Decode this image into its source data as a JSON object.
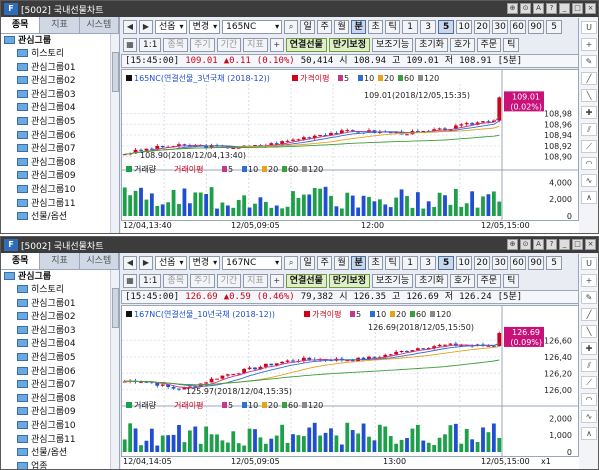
{
  "windows": [
    {
      "title": "[5002] 국내선물차트",
      "left_tabs": [
        "종목",
        "지표",
        "시스템"
      ],
      "tree_root": "관심그룹",
      "tree_items": [
        "히스토리",
        "관심그룹01",
        "관심그룹02",
        "관심그룹03",
        "관심그룹04",
        "관심그룹05",
        "관심그룹06",
        "관심그룹07",
        "관심그룹08",
        "관심그룹09",
        "관심그룹10",
        "관심그룹11",
        "선물/옵션"
      ],
      "code_label": "선옵",
      "change_label": "변경",
      "symbol": "165NC",
      "periods": [
        "일",
        "주",
        "월",
        "분",
        "초",
        "틱"
      ],
      "period_selected": "분",
      "intervals": [
        "1",
        "3",
        "5",
        "10",
        "20",
        "30",
        "60",
        "90",
        "5"
      ],
      "interval_selected": "5",
      "toolbar2": [
        "1:1",
        "종목",
        "주기",
        "기간",
        "지표",
        "연결선물",
        "만기보정",
        "보조기능",
        "초기화",
        "호가",
        "주문",
        "틱"
      ],
      "info": {
        "time": "[15:45:00]",
        "price": "109.01",
        "change": "▲0.11",
        "pct": "(0.10%)",
        "volume": "50,414",
        "open_label": "시",
        "open": "108.94",
        "high_label": "고",
        "high": "109.01",
        "low_label": "저",
        "low": "108.91",
        "period": "[5분]"
      },
      "legend": {
        "name": "165NC(연결선물_3년국채 (2018-12))",
        "ma_label": "가격이평",
        "ma": [
          "5",
          "10",
          "20",
          "60",
          "120"
        ]
      },
      "price_tag": "109.01",
      "pct_tag": "(0.02%)",
      "annot_high": "109.01(2018/12/05,15:35)",
      "annot_low": "108.90(2018/12/04,13:40)",
      "y_ticks": [
        "108,98",
        "108,96",
        "108,94",
        "108,92",
        "108,90"
      ],
      "vol_legend": {
        "vol": "거래량",
        "ma": "거래이평",
        "vals": [
          "5",
          "10",
          "20",
          "60",
          "120"
        ]
      },
      "vol_ticks": [
        "4,000",
        "2,000",
        "0"
      ],
      "x_labels": [
        "12/04,13:40",
        "12/05,09:05",
        "12:00",
        "12/05,15:00"
      ],
      "chart_data": {
        "type": "candlestick",
        "symbol": "165NC",
        "price_range": [
          108.89,
          109.02
        ],
        "volume_range": [
          0,
          5000
        ],
        "price_axis_ticks": [
          108.98,
          108.96,
          108.94,
          108.92,
          108.9
        ],
        "volume_axis_ticks": [
          4000,
          2000,
          0
        ],
        "x_axis_ticks": [
          "12/04,13:40",
          "12/05,09:05",
          "12:00",
          "12/05,15:00"
        ],
        "annotations": [
          {
            "text": "109.01(2018/12/05,15:35)",
            "value": 109.01
          },
          {
            "text": "108.90(2018/12/04,13:40)",
            "value": 108.9
          }
        ],
        "last": 109.01,
        "open": 108.94,
        "high": 109.01,
        "low": 108.91
      }
    },
    {
      "title": "[5002] 국내선물차트",
      "left_tabs": [
        "종목",
        "지표",
        "시스템"
      ],
      "tree_root": "관심그룹",
      "tree_items": [
        "히스토리",
        "관심그룹01",
        "관심그룹02",
        "관심그룹03",
        "관심그룹04",
        "관심그룹05",
        "관심그룹06",
        "관심그룹07",
        "관심그룹08",
        "관심그룹09",
        "관심그룹10",
        "관심그룹11",
        "선물/옵션",
        "업종"
      ],
      "code_label": "선옵",
      "change_label": "변경",
      "symbol": "167NC",
      "periods": [
        "일",
        "주",
        "월",
        "분",
        "초",
        "틱"
      ],
      "period_selected": "분",
      "intervals": [
        "1",
        "3",
        "5",
        "10",
        "20",
        "30",
        "60",
        "90",
        "5"
      ],
      "interval_selected": "5",
      "toolbar2": [
        "1:1",
        "종목",
        "주기",
        "기간",
        "지표",
        "연결선물",
        "만기보정",
        "보조기능",
        "초기화",
        "호가",
        "주문",
        "틱"
      ],
      "info": {
        "time": "[15:45:00]",
        "price": "126.69",
        "change": "▲0.59",
        "pct": "(0.46%)",
        "volume": "79,382",
        "open_label": "시",
        "open": "126.35",
        "high_label": "고",
        "high": "126.69",
        "low_label": "저",
        "low": "126.24",
        "period": "[5분]"
      },
      "legend": {
        "name": "167NC(연결선물_10년국채 (2018-12))",
        "ma_label": "가격이평",
        "ma": [
          "5",
          "10",
          "20",
          "60",
          "120"
        ]
      },
      "price_tag": "126.69",
      "pct_tag": "(0.09%)",
      "annot_high": "126.69(2018/12/05,15:50)",
      "annot_low": "125.97(2018/12/04,15:35)",
      "y_ticks": [
        "126,60",
        "126,40",
        "126,20",
        "126,00"
      ],
      "vol_legend": {
        "vol": "거래량",
        "ma": "거래이평",
        "vals": [
          "5",
          "10",
          "20",
          "60",
          "120"
        ]
      },
      "vol_ticks": [
        "2,000",
        "1,000",
        "0"
      ],
      "x_labels": [
        "12/04,14:05",
        "12/05,09:05",
        "13:00",
        "12/05,15:00"
      ],
      "bottom_zoom": "x1",
      "chart_data": {
        "type": "candlestick",
        "symbol": "167NC",
        "price_range": [
          125.9,
          126.75
        ],
        "volume_range": [
          0,
          2500
        ],
        "price_axis_ticks": [
          126.6,
          126.4,
          126.2,
          126.0
        ],
        "volume_axis_ticks": [
          2000,
          1000,
          0
        ],
        "x_axis_ticks": [
          "12/04,14:05",
          "12/05,09:05",
          "13:00",
          "12/05,15:00"
        ],
        "annotations": [
          {
            "text": "126.69(2018/12/05,15:50)",
            "value": 126.69
          },
          {
            "text": "125.97(2018/12/04,15:35)",
            "value": 125.97
          }
        ],
        "last": 126.69,
        "open": 126.35,
        "high": 126.69,
        "low": 126.24
      }
    }
  ],
  "colors": {
    "up": "#d0021b",
    "down": "#1f4fd0",
    "vol_up": "#1ea04a",
    "ma5": "#c0398c",
    "ma10": "#2f6fd0",
    "ma20": "#e5a21c",
    "ma60": "#3c9e3c",
    "ma120": "#8a8a8a"
  },
  "right_tool_icons": [
    "U-icon",
    "plus-icon",
    "tool-icon",
    "line-icon",
    "trend-icon",
    "cross-icon",
    "channel-icon",
    "fan-icon",
    "arc-icon",
    "wave-icon",
    "abc-icon"
  ]
}
